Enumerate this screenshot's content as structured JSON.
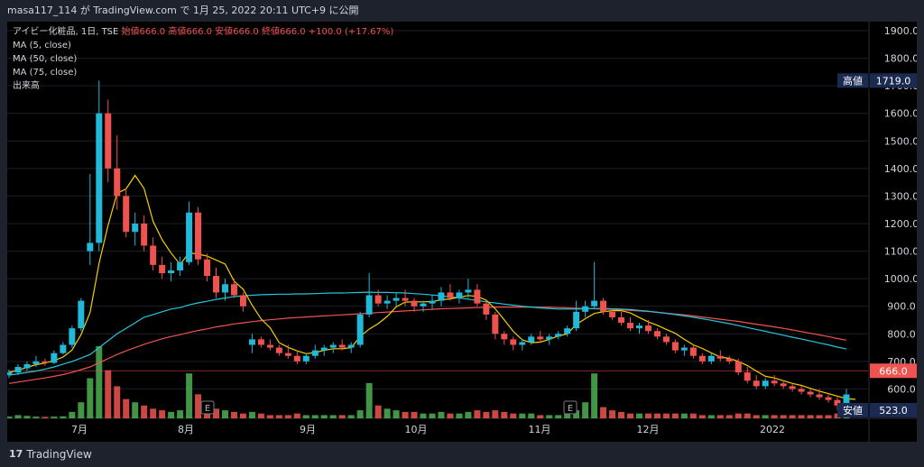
{
  "header": {
    "publisher_line": "masa117_114 が TradingView.com で 1月 25, 2022 20:11 UTC+9 に公開"
  },
  "legend": {
    "symbol_line": "アイビー化粧品, 1日, TSE",
    "ohlc_label": "始値666.0  高値666.0  安値666.0  終値666.0  +100.0 (+17.67%)",
    "ma5": "MA (5, close)",
    "ma50": "MA (50, close)",
    "ma75": "MA (75, close)",
    "volume": "出来高"
  },
  "badges": {
    "high_label": "高値",
    "high_value": "1719.0",
    "low_label": "安値",
    "low_value": "523.0",
    "last_value": "666.0"
  },
  "earnings_marker": "E",
  "footer": {
    "brand": "TradingView"
  },
  "colors": {
    "up": "#26a69a",
    "upwick": "#22b8d8",
    "down": "#ef5350",
    "ma5": "#f5d000",
    "ma50": "#26c6da",
    "ma75": "#ef5350",
    "vol_up": "#4caf50",
    "vol_down": "#ef5350"
  },
  "chart_data": {
    "type": "candlestick",
    "x_labels": [
      "7月",
      "8月",
      "9月",
      "10月",
      "11月",
      "12月",
      "2022"
    ],
    "y_ticks": [
      500,
      600,
      700,
      800,
      900,
      1000,
      1100,
      1200,
      1300,
      1400,
      1500,
      1600,
      1700,
      1800,
      1900
    ],
    "ylim": [
      490,
      1930
    ],
    "candles": [
      [
        650,
        670,
        640,
        660
      ],
      [
        660,
        690,
        650,
        680
      ],
      [
        675,
        700,
        665,
        690
      ],
      [
        690,
        720,
        680,
        700
      ],
      [
        700,
        710,
        685,
        695
      ],
      [
        695,
        740,
        690,
        730
      ],
      [
        730,
        770,
        725,
        760
      ],
      [
        760,
        830,
        750,
        820
      ],
      [
        820,
        930,
        810,
        920
      ],
      [
        1100,
        1380,
        1050,
        1130
      ],
      [
        1130,
        1719,
        1100,
        1600
      ],
      [
        1600,
        1650,
        1350,
        1400
      ],
      [
        1400,
        1520,
        1250,
        1300
      ],
      [
        1300,
        1330,
        1150,
        1170
      ],
      [
        1170,
        1240,
        1120,
        1200
      ],
      [
        1200,
        1230,
        1100,
        1120
      ],
      [
        1120,
        1150,
        1030,
        1050
      ],
      [
        1050,
        1080,
        1000,
        1020
      ],
      [
        1020,
        1060,
        990,
        1030
      ],
      [
        1030,
        1080,
        1010,
        1060
      ],
      [
        1060,
        1280,
        1050,
        1240
      ],
      [
        1240,
        1260,
        1050,
        1070
      ],
      [
        1070,
        1090,
        990,
        1010
      ],
      [
        1010,
        1040,
        930,
        950
      ],
      [
        950,
        1000,
        920,
        980
      ],
      [
        980,
        1000,
        930,
        940
      ],
      [
        940,
        950,
        880,
        900
      ],
      [
        760,
        800,
        730,
        780
      ],
      [
        780,
        790,
        750,
        760
      ],
      [
        760,
        780,
        740,
        750
      ],
      [
        750,
        760,
        720,
        730
      ],
      [
        730,
        760,
        710,
        720
      ],
      [
        720,
        740,
        690,
        700
      ],
      [
        700,
        730,
        690,
        720
      ],
      [
        720,
        760,
        710,
        740
      ],
      [
        740,
        760,
        720,
        750
      ],
      [
        750,
        770,
        730,
        760
      ],
      [
        760,
        780,
        740,
        750
      ],
      [
        750,
        770,
        730,
        760
      ],
      [
        760,
        880,
        750,
        870
      ],
      [
        870,
        1020,
        860,
        940
      ],
      [
        940,
        960,
        900,
        910
      ],
      [
        910,
        940,
        890,
        920
      ],
      [
        920,
        950,
        900,
        930
      ],
      [
        930,
        960,
        900,
        920
      ],
      [
        920,
        930,
        880,
        900
      ],
      [
        900,
        920,
        880,
        910
      ],
      [
        910,
        940,
        890,
        920
      ],
      [
        920,
        970,
        900,
        950
      ],
      [
        950,
        980,
        920,
        930
      ],
      [
        930,
        960,
        910,
        950
      ],
      [
        950,
        1000,
        930,
        960
      ],
      [
        960,
        980,
        900,
        910
      ],
      [
        910,
        920,
        850,
        870
      ],
      [
        870,
        880,
        780,
        800
      ],
      [
        800,
        810,
        760,
        780
      ],
      [
        780,
        790,
        740,
        760
      ],
      [
        760,
        780,
        740,
        770
      ],
      [
        770,
        800,
        760,
        790
      ],
      [
        790,
        810,
        770,
        780
      ],
      [
        780,
        800,
        760,
        790
      ],
      [
        790,
        810,
        780,
        800
      ],
      [
        800,
        830,
        790,
        820
      ],
      [
        820,
        920,
        810,
        880
      ],
      [
        880,
        920,
        860,
        900
      ],
      [
        900,
        1060,
        890,
        920
      ],
      [
        920,
        930,
        870,
        880
      ],
      [
        880,
        890,
        850,
        860
      ],
      [
        860,
        880,
        830,
        840
      ],
      [
        840,
        860,
        810,
        820
      ],
      [
        820,
        840,
        800,
        830
      ],
      [
        830,
        850,
        800,
        810
      ],
      [
        810,
        820,
        780,
        790
      ],
      [
        790,
        800,
        760,
        770
      ],
      [
        770,
        780,
        730,
        740
      ],
      [
        740,
        760,
        720,
        750
      ],
      [
        750,
        760,
        710,
        720
      ],
      [
        720,
        730,
        690,
        700
      ],
      [
        700,
        730,
        690,
        720
      ],
      [
        720,
        740,
        700,
        710
      ],
      [
        710,
        720,
        690,
        700
      ],
      [
        700,
        710,
        650,
        660
      ],
      [
        660,
        680,
        620,
        630
      ],
      [
        630,
        650,
        600,
        610
      ],
      [
        610,
        640,
        600,
        630
      ],
      [
        630,
        650,
        610,
        620
      ],
      [
        620,
        630,
        600,
        610
      ],
      [
        610,
        620,
        590,
        600
      ],
      [
        600,
        610,
        580,
        590
      ],
      [
        590,
        600,
        570,
        580
      ],
      [
        580,
        600,
        560,
        570
      ],
      [
        570,
        580,
        550,
        560
      ],
      [
        560,
        570,
        523,
        540
      ],
      [
        540,
        600,
        530,
        580
      ]
    ],
    "volumes": [
      0.1,
      0.2,
      0.15,
      0.1,
      0.08,
      0.1,
      0.12,
      0.4,
      1.0,
      2.5,
      4.5,
      3.0,
      2.0,
      1.2,
      1.0,
      0.8,
      0.6,
      0.5,
      0.4,
      0.5,
      2.8,
      1.5,
      0.8,
      0.6,
      0.5,
      0.4,
      0.3,
      0.4,
      0.3,
      0.2,
      0.2,
      0.2,
      0.3,
      0.2,
      0.2,
      0.2,
      0.2,
      0.2,
      0.2,
      0.5,
      2.2,
      0.8,
      0.6,
      0.5,
      0.4,
      0.4,
      0.3,
      0.3,
      0.4,
      0.3,
      0.3,
      0.4,
      0.5,
      0.4,
      0.5,
      0.4,
      0.3,
      0.3,
      0.3,
      0.2,
      0.2,
      0.2,
      0.3,
      0.5,
      1.0,
      2.8,
      0.7,
      0.5,
      0.4,
      0.3,
      0.3,
      0.3,
      0.3,
      0.3,
      0.3,
      0.3,
      0.3,
      0.2,
      0.2,
      0.2,
      0.2,
      0.3,
      0.3,
      0.2,
      0.2,
      0.2,
      0.2,
      0.2,
      0.2,
      0.2,
      0.2,
      0.2,
      0.3,
      0.3
    ],
    "ma5": [
      660,
      668,
      678,
      688,
      694,
      703,
      716,
      741,
      797,
      877,
      1056,
      1194,
      1310,
      1326,
      1375,
      1327,
      1208,
      1142,
      1093,
      1052,
      1094,
      1089,
      1082,
      1068,
      1053,
      991,
      962,
      904,
      854,
      822,
      768,
      751,
      738,
      728,
      732,
      740,
      746,
      746,
      750,
      790,
      817,
      837,
      863,
      898,
      915,
      916,
      916,
      917,
      923,
      927,
      933,
      939,
      936,
      922,
      891,
      851,
      809,
      778,
      768,
      770,
      780,
      792,
      800,
      834,
      855,
      874,
      880,
      884,
      884,
      876,
      859,
      843,
      831,
      816,
      802,
      780,
      760,
      747,
      731,
      716,
      711,
      700,
      685,
      665,
      646,
      640,
      630,
      620,
      613,
      602,
      592,
      583,
      574,
      565,
      562
    ],
    "ma50": [
      650,
      655,
      660,
      665,
      672,
      680,
      690,
      700,
      712,
      725,
      750,
      775,
      800,
      820,
      840,
      860,
      870,
      880,
      890,
      895,
      905,
      912,
      918,
      925,
      930,
      935,
      938,
      940,
      942,
      943,
      944,
      944,
      945,
      945,
      946,
      947,
      948,
      948,
      949,
      950,
      951,
      950,
      950,
      949,
      948,
      946,
      944,
      941,
      938,
      934,
      930,
      926,
      921,
      916,
      912,
      908,
      904,
      900,
      897,
      894,
      892,
      890,
      890,
      890,
      891,
      892,
      892,
      891,
      890,
      888,
      885,
      882,
      878,
      874,
      870,
      865,
      860,
      855,
      849,
      843,
      837,
      830,
      823,
      816,
      809,
      802,
      795,
      788,
      781,
      774,
      767,
      760,
      752,
      745
    ],
    "ma75": [
      620,
      625,
      630,
      635,
      640,
      646,
      652,
      660,
      670,
      680,
      695,
      710,
      725,
      738,
      750,
      762,
      772,
      782,
      790,
      797,
      805,
      812,
      818,
      825,
      830,
      836,
      840,
      844,
      848,
      851,
      854,
      857,
      859,
      861,
      863,
      865,
      867,
      869,
      871,
      873,
      875,
      877,
      879,
      881,
      883,
      885,
      887,
      889,
      891,
      892,
      893,
      894,
      895,
      896,
      897,
      897,
      897,
      897,
      897,
      896,
      896,
      895,
      894,
      893,
      892,
      891,
      890,
      889,
      887,
      885,
      883,
      881,
      878,
      875,
      872,
      869,
      865,
      861,
      857,
      853,
      849,
      845,
      840,
      835,
      830,
      825,
      820,
      814,
      808,
      802,
      796,
      790,
      783,
      777
    ]
  }
}
